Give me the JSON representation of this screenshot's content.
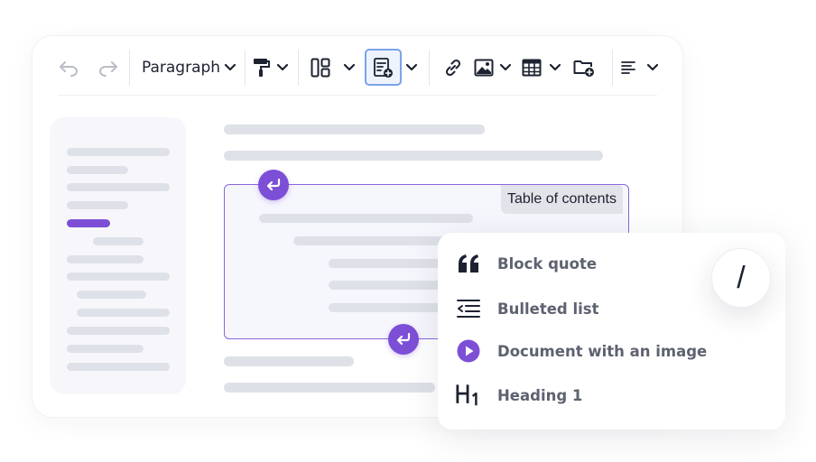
{
  "toolbar": {
    "block_style_label": "Paragraph",
    "buttons": [
      {
        "name": "undo",
        "icon": "undo-icon"
      },
      {
        "name": "redo",
        "icon": "redo-icon"
      },
      {
        "name": "format-painter",
        "icon": "paint-roller-icon"
      },
      {
        "name": "layout",
        "icon": "layout-icon"
      },
      {
        "name": "insert-toc",
        "icon": "toc-insert-icon",
        "active": true
      },
      {
        "name": "link",
        "icon": "link-icon"
      },
      {
        "name": "image",
        "icon": "image-icon"
      },
      {
        "name": "table",
        "icon": "table-icon"
      },
      {
        "name": "file-manager",
        "icon": "folder-add-icon"
      },
      {
        "name": "alignment",
        "icon": "align-left-icon"
      }
    ]
  },
  "document": {
    "toc_widget_label": "Table of contents"
  },
  "slash_menu": {
    "trigger_key": "/",
    "items": [
      {
        "label": "Block quote",
        "icon": "quote-icon"
      },
      {
        "label": "Bulleted list",
        "icon": "bulleted-list-icon"
      },
      {
        "label": "Document with an image",
        "icon": "play-circle-icon"
      },
      {
        "label": "Heading 1",
        "icon": "heading-1-icon"
      }
    ]
  },
  "colors": {
    "accent": "#7c4fd6",
    "active_border": "#7aa3e8",
    "placeholder_bar": "#dfe1e8"
  }
}
